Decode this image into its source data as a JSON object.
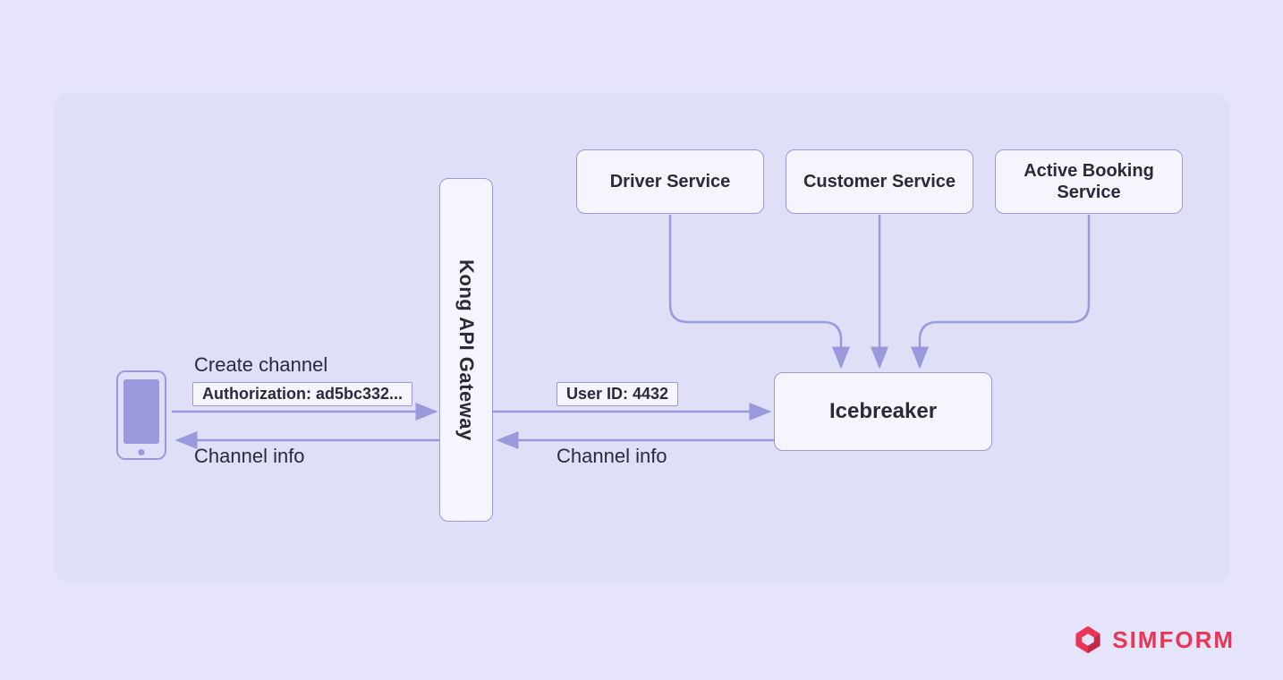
{
  "services": {
    "driver": "Driver Service",
    "customer": "Customer Service",
    "booking": "Active Booking Service"
  },
  "gateway": "Kong API Gateway",
  "core": "Icebreaker",
  "labels": {
    "create_channel": "Create channel",
    "authorization": "Authorization: ad5bc332...",
    "user_id": "User ID: 4432",
    "channel_info_left": "Channel info",
    "channel_info_right": "Channel info"
  },
  "brand": "SIMFORM",
  "colors": {
    "bg": "#E5E4FA",
    "panel": "#E0DFF8",
    "box_bg": "#F6F5FD",
    "stroke": "#9A99DB",
    "text": "#2A2A3A",
    "brand": "#EA3556"
  }
}
